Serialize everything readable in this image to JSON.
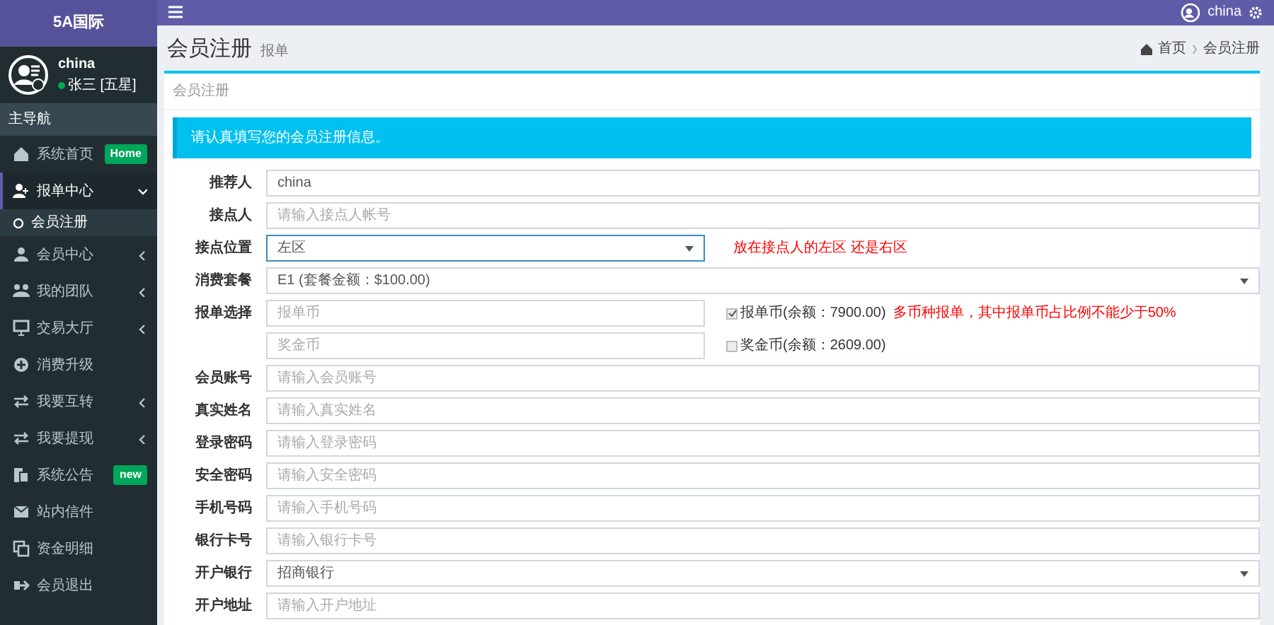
{
  "brand": "5A国际",
  "user": {
    "name": "china",
    "status": "张三 [五星]",
    "online": true
  },
  "nav_header": "主导航",
  "sidebar": {
    "items": [
      {
        "label": "系统首页",
        "badge": "Home",
        "selected": false
      },
      {
        "label": "报单中心",
        "selected": true,
        "expanded": true,
        "children": [
          {
            "label": "会员注册",
            "selected": true
          }
        ]
      },
      {
        "label": "会员中心",
        "selected": false,
        "expanded": false
      },
      {
        "label": "我的团队",
        "selected": false,
        "expanded": false
      },
      {
        "label": "交易大厅",
        "selected": false,
        "expanded": false
      },
      {
        "label": "消费升级",
        "selected": false
      },
      {
        "label": "我要互转",
        "selected": false,
        "expanded": false
      },
      {
        "label": "我要提现",
        "selected": false,
        "expanded": false
      },
      {
        "label": "系统公告",
        "badge": "new",
        "selected": false
      },
      {
        "label": "站内信件",
        "selected": false
      },
      {
        "label": "资金明细",
        "selected": false
      },
      {
        "label": "会员退出",
        "selected": false
      }
    ]
  },
  "topbar": {
    "user_name": "china"
  },
  "page": {
    "title": "会员注册",
    "subtitle": "报单",
    "breadcrumb": [
      "首页",
      "会员注册"
    ]
  },
  "box": {
    "title": "会员注册",
    "callout": "请认真填写您的会员注册信息。"
  },
  "form": [
    {
      "kind": "text",
      "label": "推荐人",
      "value": "china"
    },
    {
      "kind": "text",
      "label": "接点人",
      "placeholder": "请输入接点人帐号"
    },
    {
      "kind": "select",
      "label": "接点位置",
      "value": "左区",
      "focused": true,
      "note": "放在接点人的左区 还是右区"
    },
    {
      "kind": "select",
      "label": "消费套餐",
      "value": "E1 (套餐金额：$100.00)",
      "focused": false
    },
    {
      "kind": "multi",
      "label": "报单选择",
      "options": [
        {
          "placeholder": "报单币",
          "checked": true,
          "check_label": "报单币(余额：7900.00)",
          "note": "多币种报单，其中报单币占比例不能少于50%"
        },
        {
          "placeholder": "奖金币",
          "checked": false,
          "check_label": "奖金币(余额：2609.00)"
        }
      ]
    },
    {
      "kind": "text",
      "label": "会员账号",
      "placeholder": "请输入会员账号"
    },
    {
      "kind": "text",
      "label": "真实姓名",
      "placeholder": "请输入真实姓名"
    },
    {
      "kind": "text",
      "label": "登录密码",
      "placeholder": "请输入登录密码"
    },
    {
      "kind": "text",
      "label": "安全密码",
      "placeholder": "请输入安全密码"
    },
    {
      "kind": "text",
      "label": "手机号码",
      "placeholder": "请输入手机号码"
    },
    {
      "kind": "text",
      "label": "银行卡号",
      "placeholder": "请输入银行卡号"
    },
    {
      "kind": "select",
      "label": "开户银行",
      "value": "招商银行",
      "focused": false
    },
    {
      "kind": "text",
      "label": "开户地址",
      "placeholder": "请输入开户地址"
    }
  ]
}
